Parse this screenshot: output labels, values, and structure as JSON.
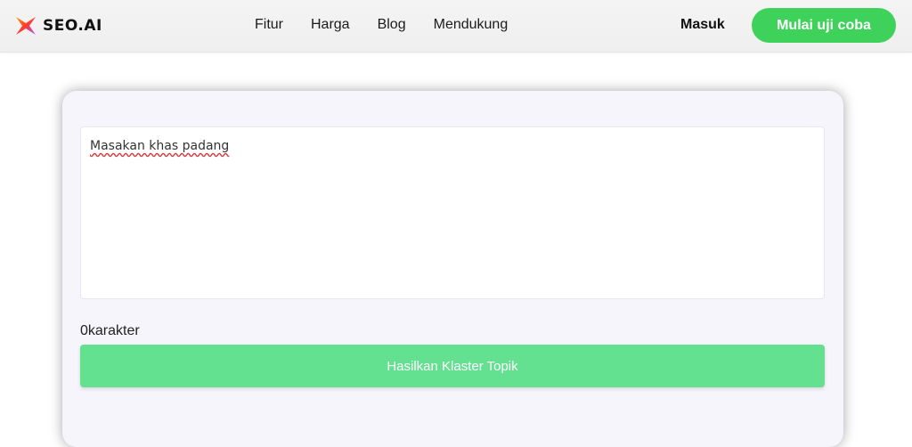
{
  "header": {
    "logo_text": "SEO.AI",
    "nav": [
      {
        "label": "Fitur"
      },
      {
        "label": "Harga"
      },
      {
        "label": "Blog"
      },
      {
        "label": "Mendukung"
      }
    ],
    "login_label": "Masuk",
    "cta_label": "Mulai uji coba",
    "colors": {
      "cta": "#3fd25a",
      "logo_gradient": [
        "#ff3b30",
        "#ff9500",
        "#b84cff"
      ]
    }
  },
  "form": {
    "textarea_value": "Masakan khas padang",
    "char_count_value": "0",
    "char_count_unit": "karakter",
    "submit_label": "Hasilkan Klaster Topik",
    "colors": {
      "submit": "#63e190"
    }
  }
}
